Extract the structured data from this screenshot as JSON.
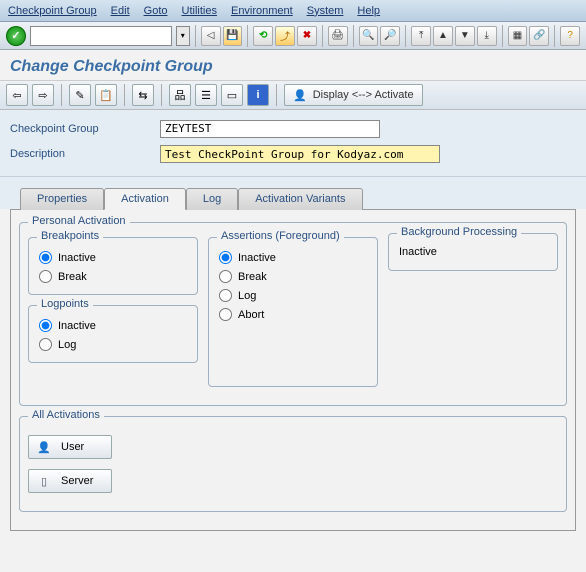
{
  "menu": [
    "Checkpoint Group",
    "Edit",
    "Goto",
    "Utilities",
    "Environment",
    "System",
    "Help"
  ],
  "title": "Change Checkpoint Group",
  "apptoolbar": {
    "display_activate": "Display <--> Activate"
  },
  "form": {
    "group_label": "Checkpoint Group",
    "group_value": "ZEYTEST",
    "desc_label": "Description",
    "desc_value": "Test CheckPoint Group for Kodyaz.com"
  },
  "tabs": [
    "Properties",
    "Activation",
    "Log",
    "Activation Variants"
  ],
  "personal_activation_label": "Personal Activation",
  "breakpoints": {
    "label": "Breakpoints",
    "inactive": "Inactive",
    "break": "Break"
  },
  "logpoints": {
    "label": "Logpoints",
    "inactive": "Inactive",
    "log": "Log"
  },
  "assertions": {
    "label": "Assertions (Foreground)",
    "inactive": "Inactive",
    "break": "Break",
    "log": "Log",
    "abort": "Abort"
  },
  "background": {
    "label": "Background Processing",
    "value": "Inactive"
  },
  "all_activations": {
    "label": "All Activations",
    "user": "User",
    "server": "Server"
  }
}
